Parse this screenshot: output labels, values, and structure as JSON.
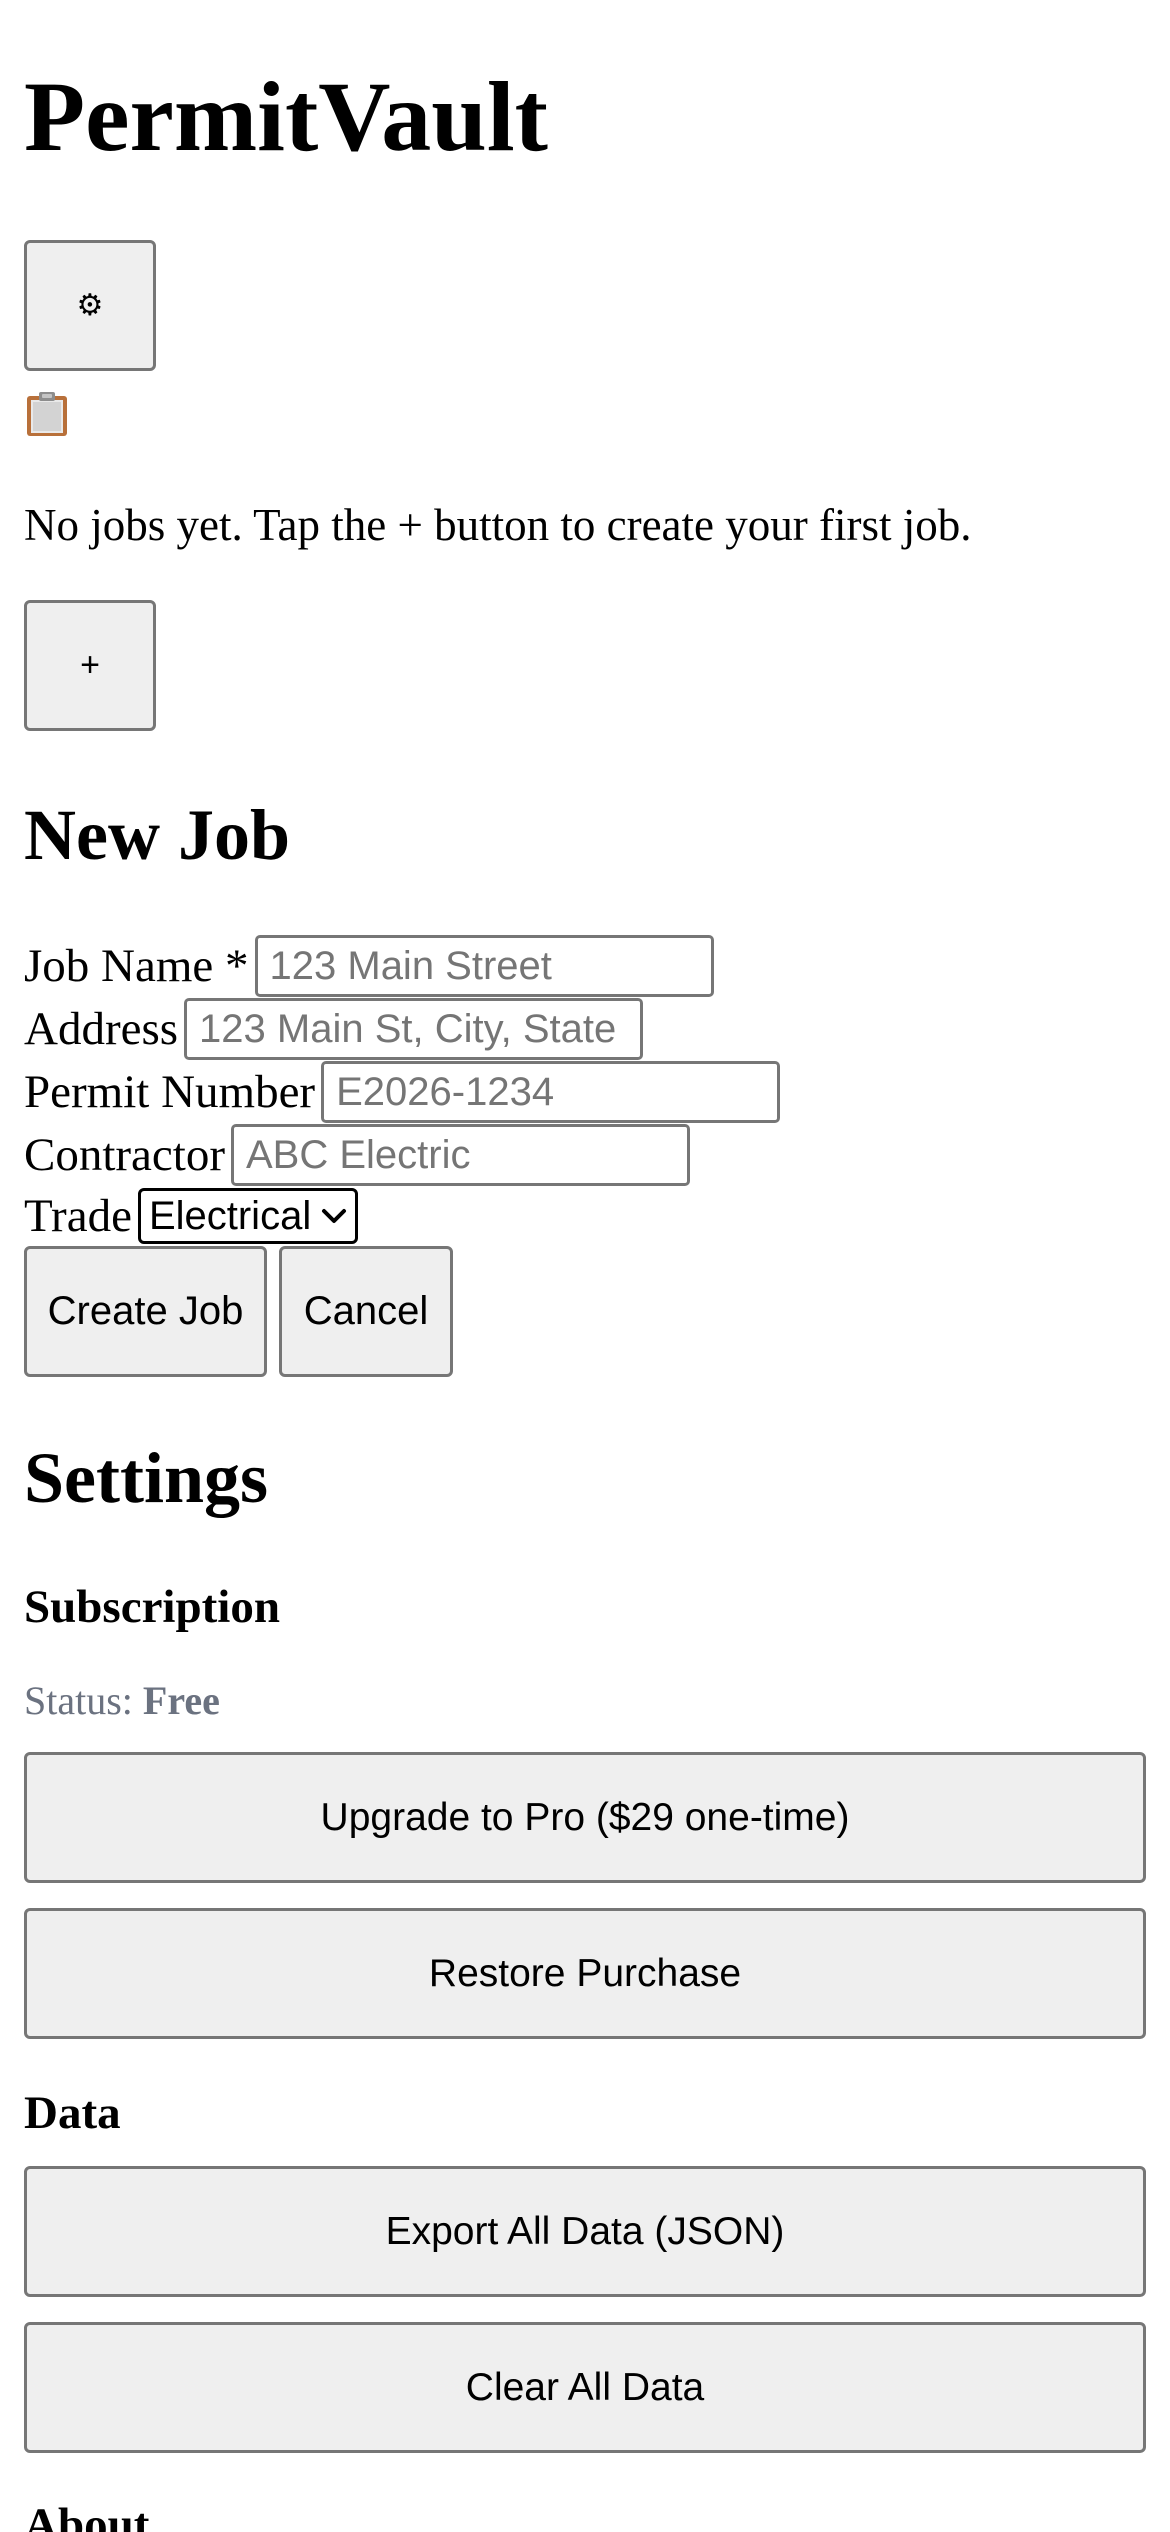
{
  "app": {
    "title": "PermitVault"
  },
  "toolbar": {
    "settings_button_icon": "gear-icon",
    "settings_button_glyph": "⚙"
  },
  "jobs": {
    "empty_icon": "clipboard-icon",
    "empty_message": "No jobs yet. Tap the + button to create your first job.",
    "add_button_label": "+"
  },
  "new_job": {
    "title": "New Job",
    "fields": {
      "job_name": {
        "label": "Job Name *",
        "value": "",
        "placeholder": "123 Main Street"
      },
      "address": {
        "label": "Address",
        "value": "",
        "placeholder": "123 Main St, City, State"
      },
      "permit_number": {
        "label": "Permit Number",
        "value": "",
        "placeholder": "E2026-1234"
      },
      "contractor": {
        "label": "Contractor",
        "value": "",
        "placeholder": "ABC Electric"
      },
      "trade": {
        "label": "Trade",
        "selected": "Electrical"
      }
    },
    "create_label": "Create Job",
    "cancel_label": "Cancel"
  },
  "settings": {
    "title": "Settings",
    "subscription": {
      "title": "Subscription",
      "status_label": "Status:",
      "status_value": "Free",
      "upgrade_label": "Upgrade to Pro ($29 one-time)",
      "restore_label": "Restore Purchase"
    },
    "data": {
      "title": "Data",
      "export_label": "Export All Data (JSON)",
      "clear_label": "Clear All Data"
    },
    "about": {
      "title": "About"
    }
  },
  "colors": {
    "button_bg": "#efefef",
    "button_border": "#767676",
    "status_text": "#6b7280",
    "placeholder": "#757575"
  }
}
